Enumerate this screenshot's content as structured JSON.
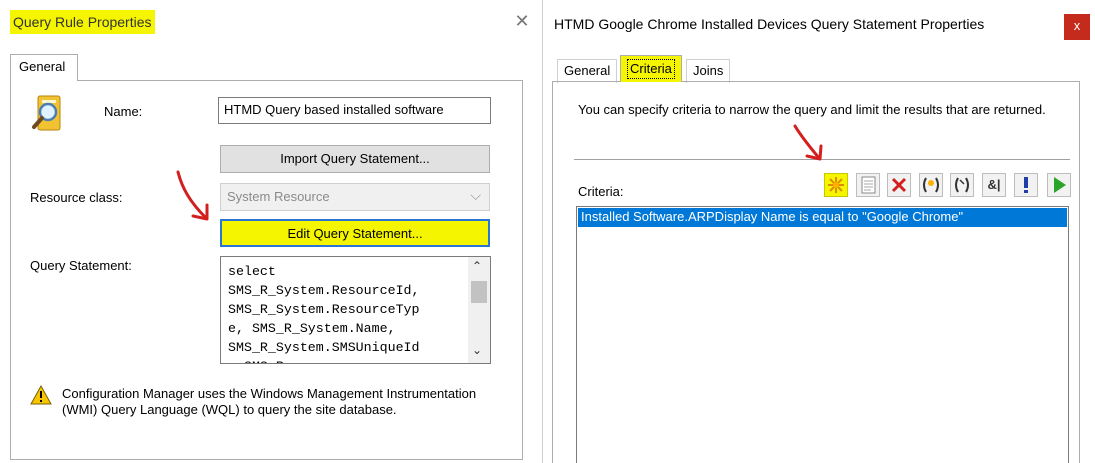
{
  "left_dialog": {
    "title": "Query Rule Properties",
    "close_glyph": "✕",
    "tab_general": "General",
    "name_label": "Name:",
    "name_value": "HTMD Query based installed software",
    "import_button": "Import Query Statement...",
    "resource_class_label": "Resource class:",
    "resource_class_value": "System Resource",
    "edit_button": "Edit Query Statement...",
    "query_statement_label": "Query Statement:",
    "query_statement_text": "select\nSMS_R_System.ResourceId,\nSMS_R_System.ResourceTyp\ne, SMS_R_System.Name,\nSMS_R_System.SMSUniqueId\n, SMS_R",
    "warning_text": "Configuration Manager uses the Windows Management Instrumentation (WMI) Query Language (WQL) to query the site database."
  },
  "right_dialog": {
    "title": "HTMD Google Chrome Installed Devices Query Statement Properties",
    "close_glyph": "x",
    "tabs": {
      "general": "General",
      "criteria": "Criteria",
      "joins": "Joins"
    },
    "description": "You can specify criteria to narrow the query and limit the results that are returned.",
    "criteria_label": "Criteria:",
    "toolbar": {
      "and_label": "&|"
    },
    "criteria_items": [
      "Installed Software.ARPDisplay Name is equal to \"Google Chrome\""
    ]
  },
  "colors": {
    "highlight": "#f5f500",
    "selection": "#0078d7",
    "close_red": "#c42b1c",
    "annotation_arrow": "#d41f1f"
  },
  "icons": [
    "query-icon",
    "warning-icon",
    "new-criterion-icon",
    "properties-icon",
    "delete-icon",
    "group-icon",
    "ungroup-icon",
    "and-or-icon",
    "not-icon",
    "run-icon",
    "chevron-down-icon"
  ]
}
